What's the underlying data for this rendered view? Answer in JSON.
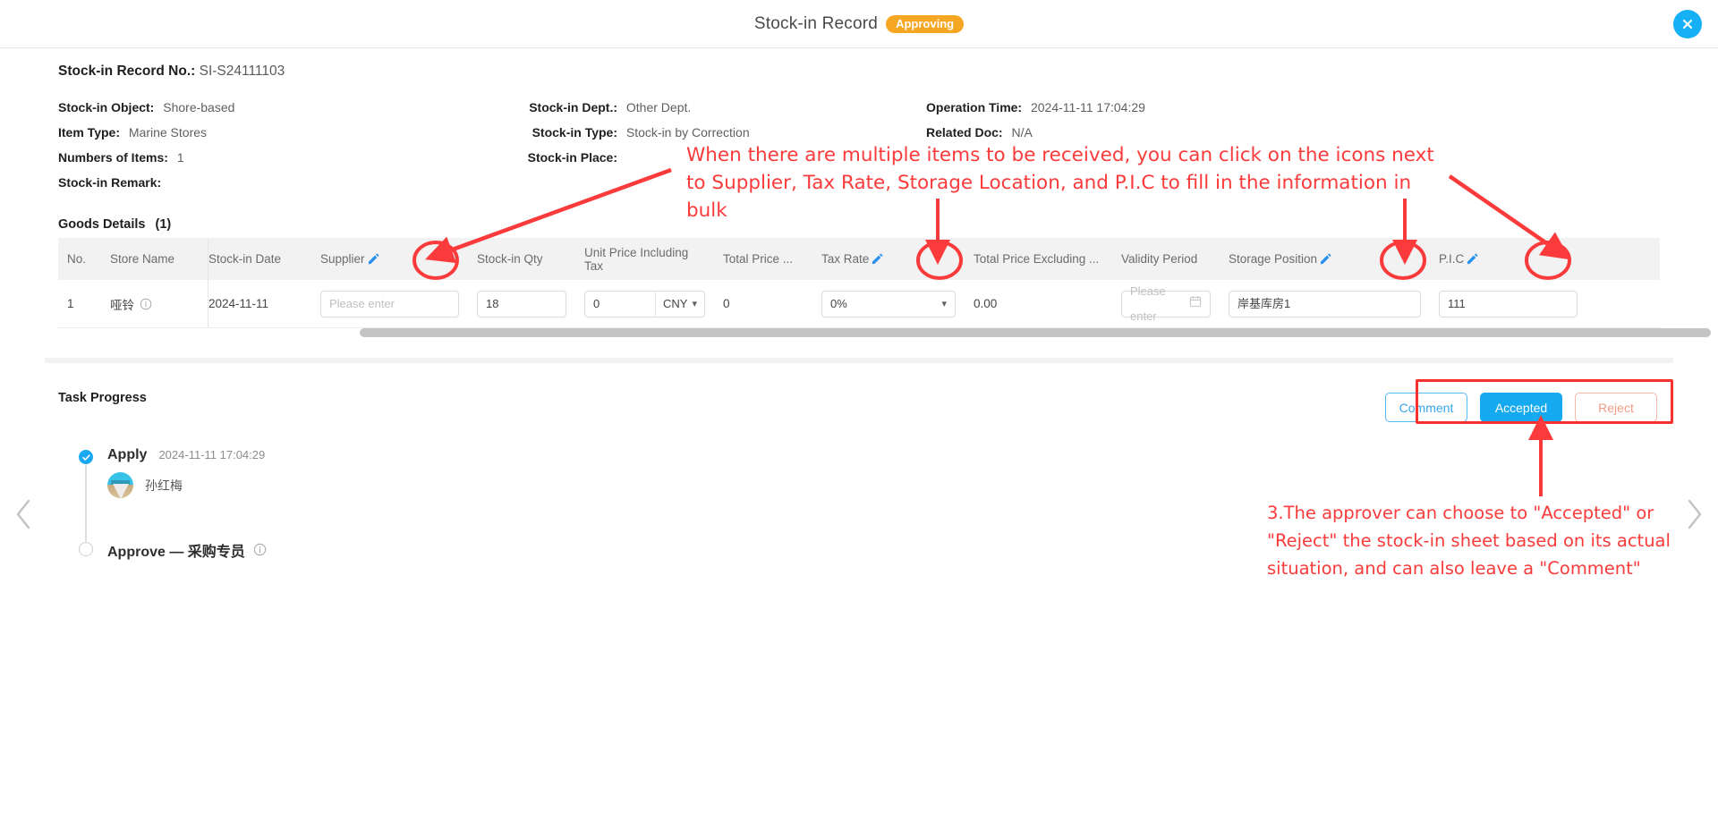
{
  "header": {
    "title": "Stock-in Record",
    "status_badge": "Approving",
    "close_icon": "close-icon"
  },
  "record": {
    "no_label": "Stock-in Record No.:",
    "no_value": "SI-S24111103",
    "left_fields": [
      {
        "label": "Stock-in Object:",
        "value": "Shore-based"
      },
      {
        "label": "Item Type:",
        "value": "Marine Stores"
      },
      {
        "label": "Numbers of Items:",
        "value": "1"
      },
      {
        "label": "Stock-in Remark:",
        "value": ""
      }
    ],
    "mid_fields": [
      {
        "label": "Stock-in Dept.:",
        "value": "Other Dept."
      },
      {
        "label": "Stock-in Type:",
        "value": "Stock-in by Correction"
      },
      {
        "label": "Stock-in Place:",
        "value": ""
      }
    ],
    "right_fields": [
      {
        "label": "Operation Time:",
        "value": "2024-11-11 17:04:29"
      },
      {
        "label": "Related Doc:",
        "value": "N/A"
      }
    ]
  },
  "goods": {
    "title": "Goods Details",
    "count": "(1)",
    "columns": {
      "no": "No.",
      "store_name": "Store Name",
      "stock_in_date": "Stock-in Date",
      "supplier": "Supplier",
      "stock_in_qty": "Stock-in Qty",
      "unit_price_incl_tax": "Unit Price Including Tax",
      "total_price": "Total Price ...",
      "tax_rate": "Tax Rate",
      "total_price_excl": "Total Price Excluding ...",
      "validity_period": "Validity Period",
      "storage_position": "Storage Position",
      "pic": "P.I.C"
    },
    "row": {
      "no": "1",
      "store_name": "哑铃",
      "stock_in_date": "2024-11-11",
      "supplier_placeholder": "Please enter",
      "supplier_value": "",
      "stock_in_qty": "18",
      "unit_price_incl_tax": "0",
      "currency": "CNY",
      "total_price": "0",
      "tax_rate": "0%",
      "total_price_excl": "0.00",
      "validity_placeholder": "Please enter",
      "validity_value": "",
      "storage_position": "岸基库房1",
      "pic": "111"
    }
  },
  "task_progress": {
    "title": "Task Progress",
    "buttons": {
      "comment": "Comment",
      "accepted": "Accepted",
      "reject": "Reject"
    },
    "steps": [
      {
        "name": "Apply",
        "time": "2024-11-11 17:04:29",
        "user": "孙红梅",
        "state": "done"
      },
      {
        "name": "Approve — 采购专员",
        "time": "",
        "user": "",
        "state": "pending"
      }
    ]
  },
  "annotations": {
    "note_1": "When there are multiple items to be received, you can click on the icons next to Supplier, Tax Rate, Storage Location, and P.I.C to fill in the information in bulk",
    "note_3": "3.The approver can choose to \"Accepted\" or \"Reject\" the stock-in sheet based on its actual situation, and can also leave a \"Comment\"",
    "color": "#fb3b3b"
  },
  "nav": {
    "prev_icon": "chevron-left-icon",
    "next_icon": "chevron-right-icon"
  },
  "colors": {
    "accent": "#15a9f0",
    "badge": "#f5a623",
    "annotation": "#fb3b3b",
    "edit_icon": "#2a90f0"
  }
}
